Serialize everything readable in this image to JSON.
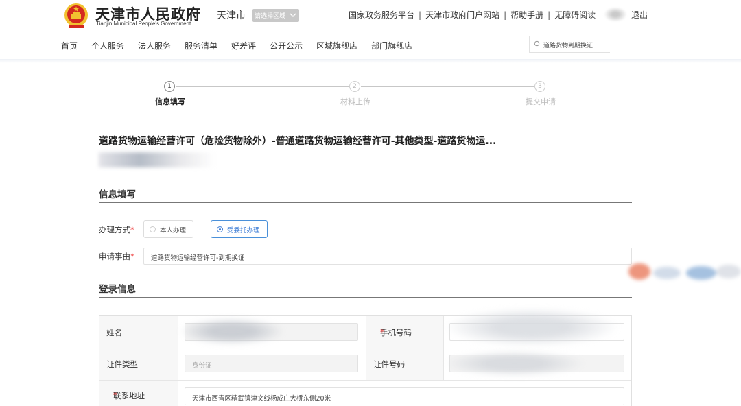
{
  "header": {
    "logo_cn": "天津市人民政府",
    "logo_en": "Tianjin Municipal People's Government",
    "city": "天津市",
    "district_select": "请选择区域",
    "top_links": [
      "国家政务服务平台",
      "天津市政府门户网站",
      "帮助手册",
      "无障碍阅读"
    ],
    "logout": "退出"
  },
  "nav": {
    "items": [
      "首页",
      "个人服务",
      "法人服务",
      "服务清单",
      "好差评",
      "公开公示",
      "区域旗舰店",
      "部门旗舰店"
    ],
    "search_value": "道路货物到期换证"
  },
  "stepper": {
    "steps": [
      {
        "num": "1",
        "label": "信息填写"
      },
      {
        "num": "2",
        "label": "材料上传"
      },
      {
        "num": "3",
        "label": "提交申请"
      }
    ],
    "current_step": 1
  },
  "main": {
    "title": "道路货物运输经营许可（危险货物除外）-普通道路货物运输经营许可-其他类型-道路货物运..."
  },
  "info_section": {
    "title": "信息填写",
    "method_label": "办理方式",
    "method_options": [
      "本人办理",
      "受委托办理"
    ],
    "method_selected": "受委托办理",
    "matter_label": "申请事由",
    "matter_value": "道路货物运输经营许可-到期换证"
  },
  "login_section": {
    "title": "登录信息",
    "name_label": "姓名",
    "phone_label": "手机号码",
    "id_type_label": "证件类型",
    "id_type_value": "身份证",
    "id_number_label": "证件号码",
    "address_label": "联系地址",
    "address_value": "天津市西青区精武镇津文线杨成庄大桥东侧20米"
  },
  "colors": {
    "accent": "#3a7bd5",
    "required": "#ee3333",
    "emblem_red": "#d42a1f",
    "emblem_gold": "#f2c230"
  }
}
